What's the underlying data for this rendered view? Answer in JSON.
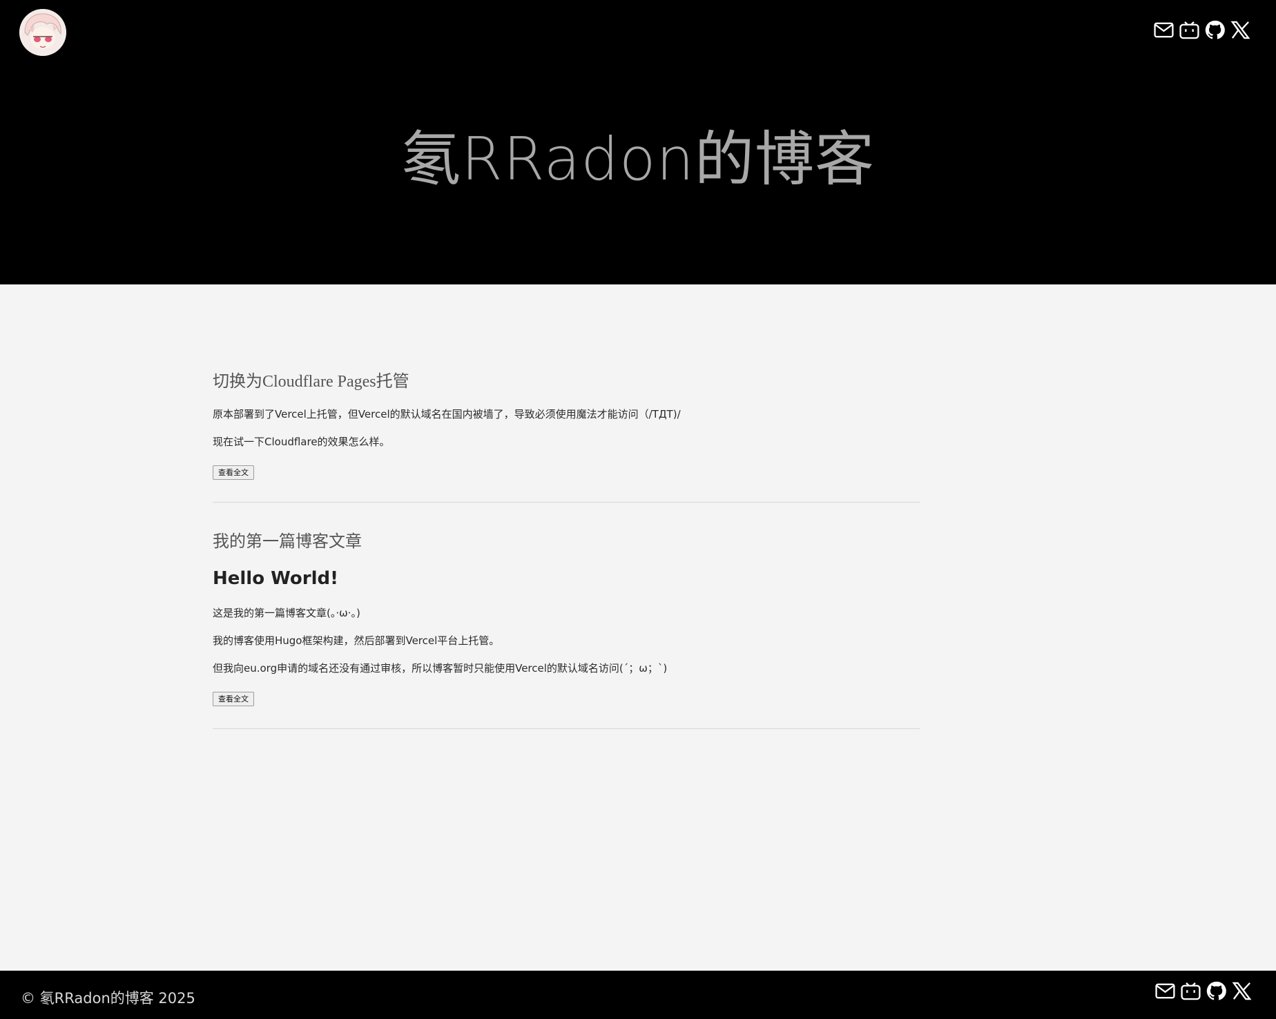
{
  "header": {
    "site_title": "氡RRadon的博客",
    "social_icons": [
      "mail-icon",
      "bilibili-icon",
      "github-icon",
      "x-icon"
    ]
  },
  "posts": [
    {
      "title": "切换为Cloudflare Pages托管",
      "heading": "",
      "paragraphs": [
        "原本部署到了Vercel上托管，但Vercel的默认域名在国内被墙了，导致必须使用魔法才能访问（/TДT)/",
        "现在试一下Cloudflare的效果怎么样。"
      ],
      "read_more": "查看全文"
    },
    {
      "title": "我的第一篇博客文章",
      "heading": "Hello World!",
      "paragraphs": [
        "这是我的第一篇博客文章(。·ω·。)",
        "我的博客使用Hugo框架构建，然后部署到Vercel平台上托管。",
        "但我向eu.org申请的域名还没有通过审核，所以博客暂时只能使用Vercel的默认域名访问(´；ω；`)"
      ],
      "read_more": "查看全文"
    }
  ],
  "footer": {
    "copyright": "© 氡RRadon的博客 2025"
  },
  "colors": {
    "header_bg": "#000000",
    "page_bg": "#f4f4f4",
    "title_color": "#a8a8a8",
    "icon_color": "#ffffff"
  }
}
